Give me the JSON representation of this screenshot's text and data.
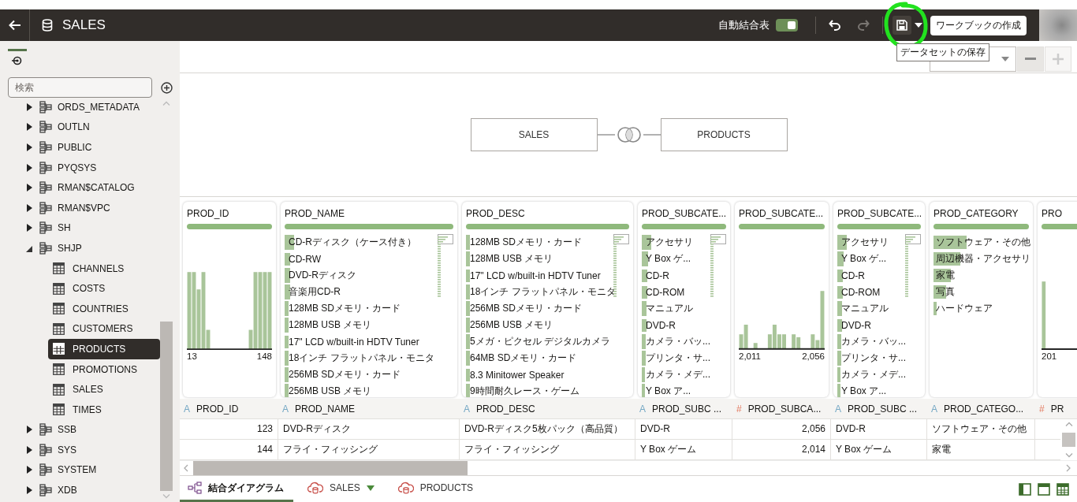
{
  "header": {
    "title": "SALES",
    "auto_join_label": "自動結合表",
    "auto_join_on": true,
    "undo_enabled": true,
    "redo_enabled": false,
    "save_highlighted": true,
    "create_workbook": "ワークブックの作成"
  },
  "tooltip": "データセットの保存",
  "zoom": {
    "zoom_out_enabled": true,
    "zoom_in_enabled": false
  },
  "sidebar": {
    "search_placeholder": "検索",
    "tree": [
      {
        "label": "ORDS_METADATA",
        "kind": "schema",
        "expanded": false
      },
      {
        "label": "OUTLN",
        "kind": "schema",
        "expanded": false
      },
      {
        "label": "PUBLIC",
        "kind": "schema",
        "expanded": false
      },
      {
        "label": "PYQSYS",
        "kind": "schema",
        "expanded": false
      },
      {
        "label": "RMAN$CATALOG",
        "kind": "schema",
        "expanded": false
      },
      {
        "label": "RMAN$VPC",
        "kind": "schema",
        "expanded": false
      },
      {
        "label": "SH",
        "kind": "schema",
        "expanded": false
      },
      {
        "label": "SHJP",
        "kind": "schema",
        "expanded": true,
        "children": [
          {
            "label": "CHANNELS",
            "kind": "table",
            "selected": false
          },
          {
            "label": "COSTS",
            "kind": "table",
            "selected": false
          },
          {
            "label": "COUNTRIES",
            "kind": "table",
            "selected": false
          },
          {
            "label": "CUSTOMERS",
            "kind": "table",
            "selected": false
          },
          {
            "label": "PRODUCTS",
            "kind": "table",
            "selected": true
          },
          {
            "label": "PROMOTIONS",
            "kind": "table",
            "selected": false
          },
          {
            "label": "SALES",
            "kind": "table",
            "selected": false
          },
          {
            "label": "TIMES",
            "kind": "table",
            "selected": false
          }
        ]
      },
      {
        "label": "SSB",
        "kind": "schema",
        "expanded": false
      },
      {
        "label": "SYS",
        "kind": "schema",
        "expanded": false
      },
      {
        "label": "SYSTEM",
        "kind": "schema",
        "expanded": false
      },
      {
        "label": "XDB",
        "kind": "schema",
        "expanded": false
      }
    ]
  },
  "diagram": {
    "left": "SALES",
    "right": "PRODUCTS"
  },
  "columns": [
    {
      "type": "A",
      "header": "PROD_ID",
      "profile": {
        "title": "PROD_ID",
        "kind": "histogram",
        "min": "13",
        "max": "148"
      }
    },
    {
      "type": "A",
      "header": "PROD_NAME",
      "profile": {
        "title": "PROD_NAME",
        "kind": "list",
        "items": [
          {
            "text": "CD-Rディスク（ケース付き）"
          },
          {
            "text": "CD-RW"
          },
          {
            "text": "DVD-Rディスク"
          },
          {
            "text": "音楽用CD-R"
          },
          {
            "text": "128MB SDメモリ・カード"
          },
          {
            "text": "128MB USB メモリ"
          },
          {
            "text": "17\" LCD w/built-in HDTV Tuner"
          },
          {
            "text": "18インチ フラットパネル・モニタ"
          },
          {
            "text": "256MB SDメモリ・カード"
          },
          {
            "text": "256MB USB メモリ"
          }
        ]
      }
    },
    {
      "type": "A",
      "header": "PROD_DESC",
      "profile": {
        "title": "PROD_DESC",
        "kind": "list",
        "items": [
          {
            "text": "128MB SDメモリ・カード"
          },
          {
            "text": "128MB USB メモリ"
          },
          {
            "text": "17\" LCD w/built-in HDTV Tuner"
          },
          {
            "text": "18インチ フラットパネル・モニタ"
          },
          {
            "text": "256MB SDメモリ・カード"
          },
          {
            "text": "256MB USB メモリ"
          },
          {
            "text": "5メガ・ピクセル デジタルカメラ"
          },
          {
            "text": "64MB SDメモリ・カード"
          },
          {
            "text": "8.3 Minitower Speaker"
          },
          {
            "text": "9時間耐久レース・ゲーム"
          }
        ]
      }
    },
    {
      "type": "A",
      "header": "PROD_SUBC ...",
      "profile": {
        "title": "PROD_SUBCATE...",
        "kind": "list",
        "items": [
          {
            "text": "アクセサリ"
          },
          {
            "text": "Y Box ゲ..."
          },
          {
            "text": "CD-R"
          },
          {
            "text": "CD-ROM"
          },
          {
            "text": "マニュアル"
          },
          {
            "text": "DVD-R"
          },
          {
            "text": "カメラ・バッ..."
          },
          {
            "text": "プリンタ・サ..."
          },
          {
            "text": "カメラ・メデ..."
          },
          {
            "text": "Y Box ア..."
          }
        ]
      }
    },
    {
      "type": "#",
      "header": "PROD_SUBCA...",
      "profile": {
        "title": "PROD_SUBCATE...",
        "kind": "histogram",
        "min": "2,011",
        "max": "2,056"
      }
    },
    {
      "type": "A",
      "header": "PROD_SUBC ...",
      "profile": {
        "title": "PROD_SUBCATE...",
        "kind": "list",
        "items": [
          {
            "text": "アクセサリ"
          },
          {
            "text": "Y Box ゲ..."
          },
          {
            "text": "CD-R"
          },
          {
            "text": "CD-ROM"
          },
          {
            "text": "マニュアル"
          },
          {
            "text": "DVD-R"
          },
          {
            "text": "カメラ・バッ..."
          },
          {
            "text": "プリンタ・サ..."
          },
          {
            "text": "カメラ・メデ..."
          },
          {
            "text": "Y Box ア..."
          }
        ]
      }
    },
    {
      "type": "A",
      "header": "PROD_CATEGO...",
      "profile": {
        "title": "PROD_CATEGORY",
        "kind": "list",
        "items": [
          {
            "text": "ソフトウェア・その他"
          },
          {
            "text": "周辺機器・アクセサリ"
          },
          {
            "text": "家電"
          },
          {
            "text": "写真"
          },
          {
            "text": "ハードウェア"
          }
        ]
      }
    },
    {
      "type": "#",
      "header": "PR",
      "profile": {
        "title": "PRO",
        "kind": "histogram",
        "min": "201"
      }
    }
  ],
  "rows": [
    [
      "123",
      "DVD-Rディスク",
      "DVD-Rディスク5枚パック（高品質）",
      "DVD-R",
      "2,056",
      "DVD-R",
      "ソフトウェア・その他"
    ],
    [
      "144",
      "フライ・フィッシング",
      "フライ・フィッシング",
      "Y Box ゲーム",
      "2,014",
      "Y Box ゲーム",
      "家電"
    ]
  ],
  "tabs": [
    {
      "label": "結合ダイアグラム",
      "kind": "diagram",
      "selected": true
    },
    {
      "label": "SALES",
      "kind": "source",
      "selected": false,
      "menu": true
    },
    {
      "label": "PRODUCTS",
      "kind": "source",
      "selected": false,
      "menu": false
    }
  ]
}
